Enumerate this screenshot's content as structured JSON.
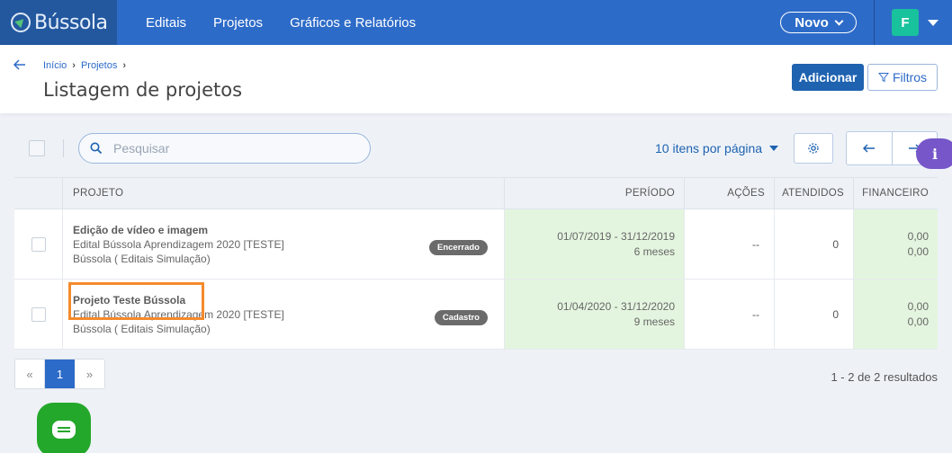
{
  "app": {
    "logo_text": "Bússola",
    "nav": [
      "Editais",
      "Projetos",
      "Gráficos e Relatórios"
    ],
    "novo_label": "Novo",
    "user_initial": "F",
    "colors": {
      "topbar": "#2d6bc8",
      "primary": "#1e62b0",
      "avatar": "#18c29c",
      "accent_highlight": "#f58a2c",
      "chat": "#24a82b",
      "info": "#7656c8"
    }
  },
  "header": {
    "breadcrumb": [
      "Início",
      "Projetos"
    ],
    "title": "Listagem de projetos",
    "add_label": "Adicionar",
    "filter_label": "Filtros"
  },
  "toolbar": {
    "search_placeholder": "Pesquisar",
    "per_page": "10 itens por página",
    "info_icon": "i"
  },
  "table": {
    "columns": [
      "PROJETO",
      "PERÍODO",
      "AÇÕES",
      "ATENDIDOS",
      "FINANCEIRO"
    ],
    "rows": [
      {
        "name": "Edição de vídeo e imagem",
        "edital": "Edital Bússola Aprendizagem 2020 [TESTE]",
        "org": "Bússola ( Editais Simulação)",
        "status": "Encerrado",
        "periodo": "01/07/2019 - 31/12/2019",
        "duracao": "6 meses",
        "acoes": "--",
        "atendidos": "0",
        "fin1": "0,00",
        "fin2": "0,00"
      },
      {
        "name": "Projeto Teste Bússola",
        "edital": "Edital Bússola Aprendizagem 2020 [TESTE]",
        "org": "Bússola ( Editais Simulação)",
        "status": "Cadastro",
        "periodo": "01/04/2020 - 31/12/2020",
        "duracao": "9 meses",
        "acoes": "--",
        "atendidos": "0",
        "fin1": "0,00",
        "fin2": "0,00"
      }
    ]
  },
  "pagination": {
    "prev": "«",
    "current": "1",
    "next": "»",
    "results": "1 - 2 de 2 resultados"
  }
}
